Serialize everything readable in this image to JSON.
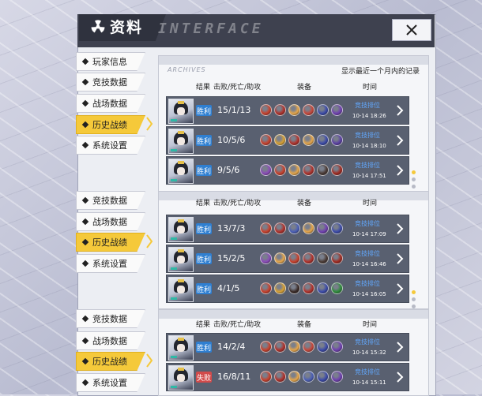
{
  "window": {
    "title": "资料",
    "interface_deco": "INTERFACE",
    "close_label": "✕"
  },
  "nav_groups": [
    {
      "items": [
        "玩家信息",
        "竞技数据",
        "战场数据",
        "历史战绩",
        "系统设置"
      ],
      "active_index": 3
    },
    {
      "items": [
        "竞技数据",
        "战场数据",
        "历史战绩",
        "系统设置"
      ],
      "active_index": 2
    },
    {
      "items": [
        "竞技数据",
        "战场数据",
        "历史战绩",
        "系统设置"
      ],
      "active_index": 2
    }
  ],
  "panel": {
    "archives_label": "ARCHIVES",
    "recent_label": "显示最近一个月内的记录",
    "headers": {
      "result": "结果",
      "kda": "击败/死亡/助攻",
      "equipment": "装备",
      "time": "时间"
    },
    "rank_label": "竞技排位"
  },
  "match_groups": [
    [
      {
        "result": "胜利",
        "status": "win",
        "kda": "15/1/13",
        "time": "10-14 18:26",
        "items": [
          "#c8402b",
          "#b0312a",
          "#e6a64a",
          "#c7473a",
          "#3b4aa8",
          "#6f3fb0"
        ]
      },
      {
        "result": "胜利",
        "status": "win",
        "kda": "10/5/6",
        "time": "10-14 18:10",
        "items": [
          "#c8402b",
          "#d8a032",
          "#b0312a",
          "#e6a64a",
          "#3b4aa8",
          "#5a3fa3"
        ]
      },
      {
        "result": "胜利",
        "status": "win",
        "kda": "9/5/6",
        "time": "10-14 17:51",
        "items": [
          "#8a4bb8",
          "#c8402b",
          "#e6a64a",
          "#b0312a",
          "#4a3a34",
          "#a12a20"
        ]
      }
    ],
    [
      {
        "result": "胜利",
        "status": "win",
        "kda": "13/7/3",
        "time": "10-14 17:09",
        "items": [
          "#c8402b",
          "#b0312a",
          "#4b5fb5",
          "#e6a64a",
          "#6f3fb0",
          "#3b4aa8"
        ]
      },
      {
        "result": "胜利",
        "status": "win",
        "kda": "15/2/5",
        "time": "10-14 16:46",
        "items": [
          "#8a4bb8",
          "#e6a64a",
          "#c8402b",
          "#b0312a",
          "#4a3a34",
          "#a12a20"
        ]
      },
      {
        "result": "胜利",
        "status": "win",
        "kda": "4/1/5",
        "time": "10-14 16:05",
        "items": [
          "#c8402b",
          "#d8a032",
          "#3a2a26",
          "#b0312a",
          "#3b4aa8",
          "#2e8b3a"
        ]
      }
    ],
    [
      {
        "result": "胜利",
        "status": "win",
        "kda": "14/2/4",
        "time": "10-14 15:32",
        "items": [
          "#c8402b",
          "#b0312a",
          "#e6a64a",
          "#c7473a",
          "#3b4aa8",
          "#6f3fb0"
        ]
      },
      {
        "result": "失败",
        "status": "loss",
        "kda": "16/8/11",
        "time": "10-14 15:11",
        "items": [
          "#c8402b",
          "#b0312a",
          "#e6a64a",
          "#4b5fb5",
          "#3b4aa8",
          "#6f3fb0"
        ]
      }
    ]
  ]
}
